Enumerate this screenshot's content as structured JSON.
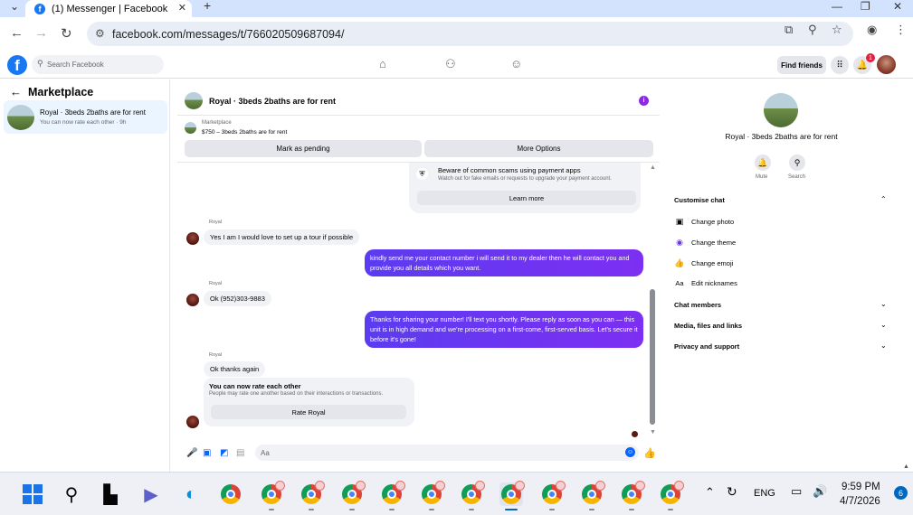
{
  "browser": {
    "tab_title": "(1) Messenger | Facebook",
    "tab_close": "✕",
    "new_tab": "+",
    "url": "facebook.com/messages/t/766020509687094/"
  },
  "fb_nav": {
    "search_placeholder": "Search Facebook",
    "find_friends": "Find friends",
    "notification_count": "1"
  },
  "sidebar": {
    "header": "Marketplace",
    "conversation": {
      "title": "Royal · 3beds 2baths are for rent",
      "subtitle": "You can now rate each other · 9h"
    }
  },
  "chat": {
    "title": "Royal · 3beds 2baths are for rent",
    "marketplace_label": "Marketplace",
    "listing": "$750 – 3beds 2baths are for rent",
    "mark_pending": "Mark as pending",
    "more_options": "More Options",
    "scam_title": "Beware of common scams using payment apps",
    "scam_sub": "Watch out for fake emails or requests to upgrade your payment account.",
    "learn_more": "Learn more",
    "messages": [
      {
        "sender": "Royal",
        "text": "Yes I am I would love to set up a tour if possible"
      },
      {
        "text": "kindly send me your contact number i will send it to my dealer then he will contact you and provide you all details which you want."
      },
      {
        "sender": "Royal",
        "text": "Ok (952)303-9883"
      },
      {
        "text": "Thanks for sharing your number! I'll text you shortly. Please reply as soon as you can — this unit is in high demand and we're processing on a first-come, first-served basis. Let's secure it before it's gone!"
      },
      {
        "sender": "Royal",
        "text": "Ok thanks again"
      }
    ],
    "rate_title": "You can now rate each other",
    "rate_sub": "People may rate one another based on their interactions or transactions.",
    "rate_button": "Rate Royal",
    "input_placeholder": "Aa"
  },
  "right_panel": {
    "title": "Royal · 3beds 2baths are for rent",
    "mute": "Mute",
    "search": "Search",
    "customise_chat": "Customise chat",
    "change_photo": "Change photo",
    "change_theme": "Change theme",
    "change_emoji": "Change emoji",
    "edit_nicknames": "Edit nicknames",
    "nickname_icon": "Aa",
    "chat_members": "Chat members",
    "media": "Media, files and links",
    "privacy": "Privacy and support"
  },
  "taskbar": {
    "language": "ENG",
    "time": "9:59 PM",
    "date": "4/7/2026",
    "notifications": "6"
  },
  "colors": {
    "fb_blue": "#1877f2",
    "outgoing_bubble": "#6b35f4",
    "selected_conversation": "#ebf5ff"
  }
}
